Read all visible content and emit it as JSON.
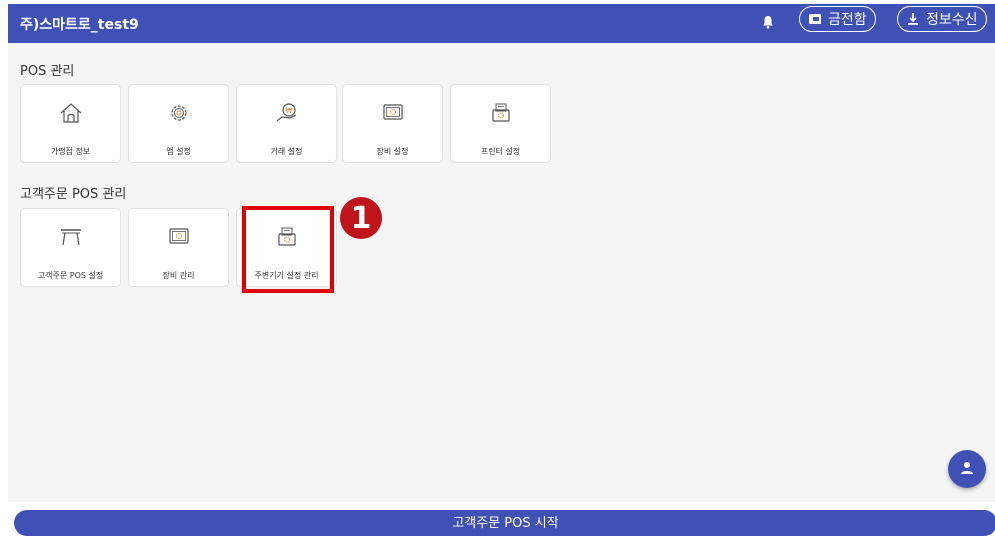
{
  "header": {
    "title": "주)스마트로_test9",
    "cash_drawer_label": "금전함",
    "receive_info_label": "정보수신"
  },
  "sections": [
    {
      "title": "POS 관리",
      "items": [
        {
          "label": "가맹점 정보",
          "icon": "house-icon"
        },
        {
          "label": "앱 설정",
          "icon": "gear-icon"
        },
        {
          "label": "거래 설정",
          "icon": "won-hand-icon"
        },
        {
          "label": "장비 설정",
          "icon": "monitor-gear-icon"
        },
        {
          "label": "프린터 설정",
          "icon": "printer-gear-icon"
        }
      ]
    },
    {
      "title": "고객주문 POS 관리",
      "items": [
        {
          "label": "고객주문 POS 설정",
          "icon": "table-icon"
        },
        {
          "label": "장비 관리",
          "icon": "monitor-gear-icon"
        },
        {
          "label": "주변기기 설정 관리",
          "icon": "printer-gear-icon"
        }
      ]
    }
  ],
  "annotation": {
    "number": "1"
  },
  "footer": {
    "start_label": "고객주문 POS 시작"
  },
  "colors": {
    "primary": "#3f51b5",
    "highlight": "#e00000",
    "badge": "#c0141b"
  }
}
